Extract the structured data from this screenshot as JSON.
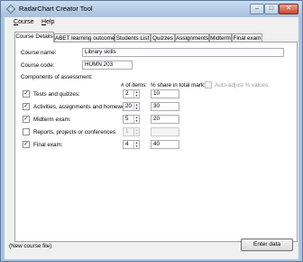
{
  "window": {
    "title": "RadarChart Creator Tool"
  },
  "menu": {
    "items": [
      "Course",
      "Help"
    ]
  },
  "tabs": [
    "Course Details",
    "ABET learning outcomes",
    "Students List",
    "Quizzes",
    "Assignments",
    "Midterm",
    "Final exam"
  ],
  "course": {
    "name_label": "Course name:",
    "name_value": "Library skills",
    "code_label": "Course code:",
    "code_value": "HUMN 203"
  },
  "assessment": {
    "header": "Components of assessment:",
    "col_items": "# of items:",
    "col_share": "% share in total mark:",
    "auto_adjust_label": "Auto-adjust % values",
    "rows": [
      {
        "label": "Tests and quizzes:",
        "checked": true,
        "items": "2",
        "share": "10"
      },
      {
        "label": "Activities, assignments and homeworks:",
        "checked": true,
        "items": "20",
        "share": "30"
      },
      {
        "label": "Midterm exam:",
        "checked": true,
        "items": "5",
        "share": "20"
      },
      {
        "label": "Reports, projects or conferences",
        "checked": false,
        "items": "1",
        "share": ""
      },
      {
        "label": "Final exam:",
        "checked": true,
        "items": "4",
        "share": "40"
      }
    ]
  },
  "status": {
    "text": "(New course file)"
  },
  "actions": {
    "enter_data": "Enter data"
  },
  "icons": {
    "app": "radar-chart-icon",
    "minimize": "minimize-icon",
    "maximize": "maximize-icon",
    "close": "close-icon"
  }
}
